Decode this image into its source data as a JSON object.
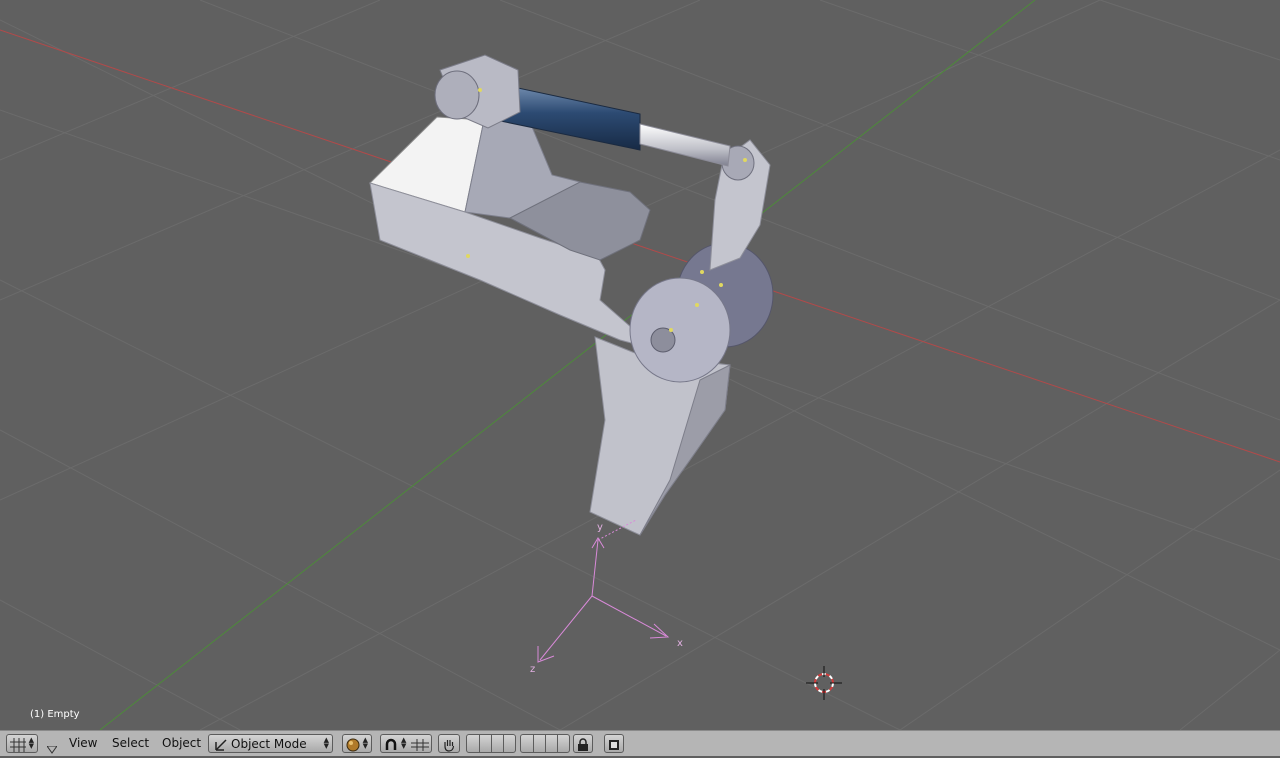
{
  "viewport": {
    "object_label": "(1) Empty",
    "axis_labels": {
      "x": "x",
      "y": "y",
      "z": "z"
    }
  },
  "header": {
    "menus": {
      "view": "View",
      "select": "Select",
      "object": "Object"
    },
    "mode": "Object Mode",
    "icons": {
      "editor_type": "grid-icon",
      "collapse": "triangle-down-icon",
      "shading": "solid-sphere-icon",
      "pivot": "magnet-icon",
      "manipulator": "hand-icon",
      "layers_lock": "lock-icon",
      "render": "render-icon"
    }
  }
}
